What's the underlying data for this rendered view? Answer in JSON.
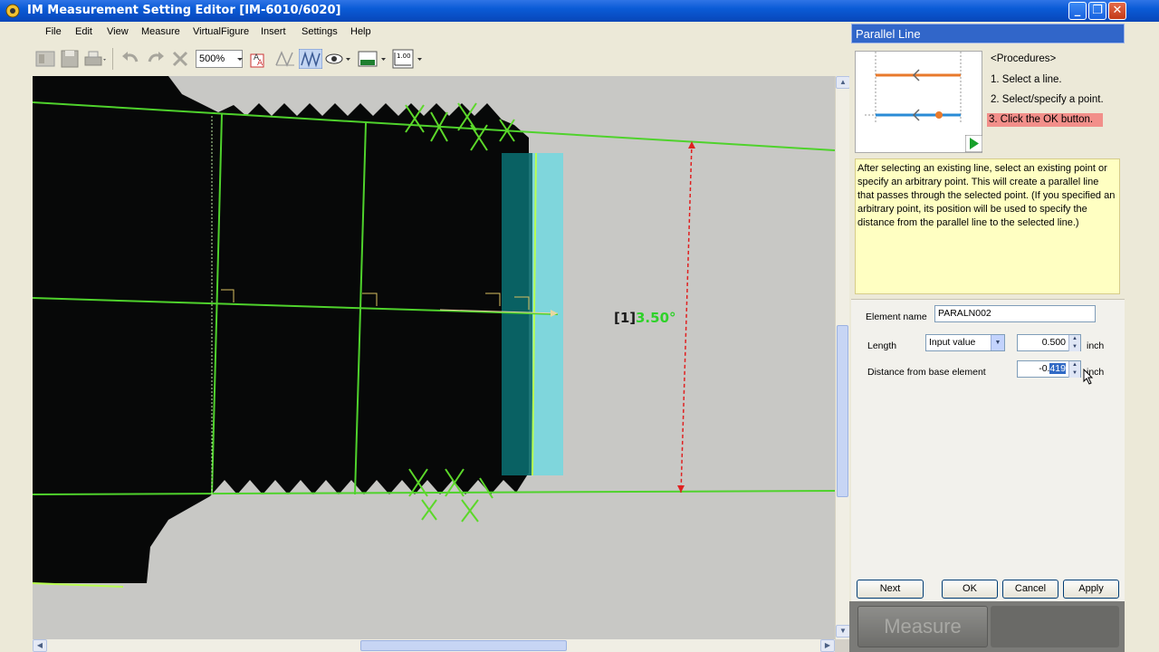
{
  "window": {
    "title": "IM Measurement Setting Editor  [IM-6010/6020]",
    "controls": [
      "minimize-icon",
      "restore-icon",
      "close-icon"
    ]
  },
  "menu": [
    "File",
    "Edit",
    "View",
    "Measure",
    "VirtualFigure",
    "Insert",
    "Settings",
    "Help"
  ],
  "toolbar": {
    "zoom": "500%",
    "scale_value": "1.00"
  },
  "canvas": {
    "angle_label": "[1]",
    "angle_value": "3.50°"
  },
  "panel": {
    "title": "Parallel Line",
    "procedures_title": "<Procedures>",
    "steps": [
      "1. Select a line.",
      "2. Select/specify a point.",
      "3. Click the OK button."
    ],
    "description": "After selecting an existing line, select an existing point or specify an arbitrary point. This will create a parallel line that passes through the selected point. (If you specified an arbitrary point, its position will be used to specify the distance from the parallel line to the selected line.)",
    "element_name_label": "Element name",
    "element_name_value": "PARALN002",
    "length_label": "Length",
    "length_mode": "Input value",
    "length_value": "0.500",
    "length_unit": "inch",
    "distance_label": "Distance from base element",
    "distance_value_prefix": "-0.",
    "distance_value_selected": "419",
    "distance_unit": "inch",
    "buttons": {
      "next": "Next",
      "ok": "OK",
      "cancel": "Cancel",
      "apply": "Apply"
    },
    "measure": "Measure"
  },
  "colors": {
    "title_blue": "#0a5bd6",
    "overlay_green": "#4fd22c",
    "selected_cyan": "#7fd6dc",
    "measure_red": "#e02020",
    "step_highlight": "#f28f8a",
    "note_yellow": "#ffffc2"
  }
}
